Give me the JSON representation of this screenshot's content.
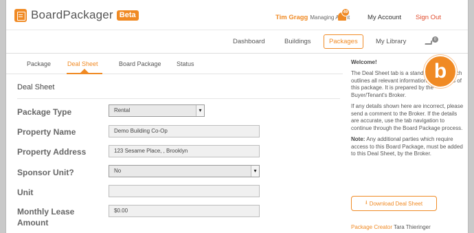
{
  "app": {
    "name": "BoardPackager",
    "badge": "Beta"
  },
  "user": {
    "name": "Tim Gragg",
    "role": "Managing Agent",
    "notifications": "49",
    "account": "My Account",
    "signout": "Sign Out"
  },
  "nav": {
    "items": [
      "Dashboard",
      "Buildings",
      "Packages",
      "My Library"
    ],
    "cart_count": "0"
  },
  "tabs": [
    "Package",
    "Deal Sheet",
    "Board Package",
    "Status"
  ],
  "section_title": "Deal Sheet",
  "form": {
    "package_type": {
      "label": "Package Type",
      "value": "Rental"
    },
    "property_name": {
      "label": "Property Name",
      "value": "Demo Building Co-Op"
    },
    "property_address": {
      "label": "Property Address",
      "value": "123 Sesame Place, , Brooklyn"
    },
    "sponsor_unit": {
      "label": "Sponsor Unit?",
      "value": "No"
    },
    "unit": {
      "label": "Unit",
      "value": ""
    },
    "monthly_lease": {
      "label": "Monthly Lease Amount",
      "value": "$0.00"
    }
  },
  "sidebar": {
    "title": "Welcome!",
    "p1": "The Deal Sheet tab is a standard sheet which outlines all relevant information and parties of this package. It is prepared by the Buyer/Tenant's Broker.",
    "p2": "If any details shown here are incorrect, please send a comment to the Broker. If the details are accurate, use the tab navigation to continue through the Board Package process.",
    "note_label": "Note:",
    "p3": "Any additional parties which require access to this Board Package, must be added to this Deal Sheet, by the Broker.",
    "download": "Download Deal Sheet",
    "creator_label": "Package Creator",
    "creator_name": "Tara Thieringer"
  },
  "badge_letter": "b",
  "colors": {
    "accent": "#f08a24",
    "signout": "#e04b2c"
  }
}
